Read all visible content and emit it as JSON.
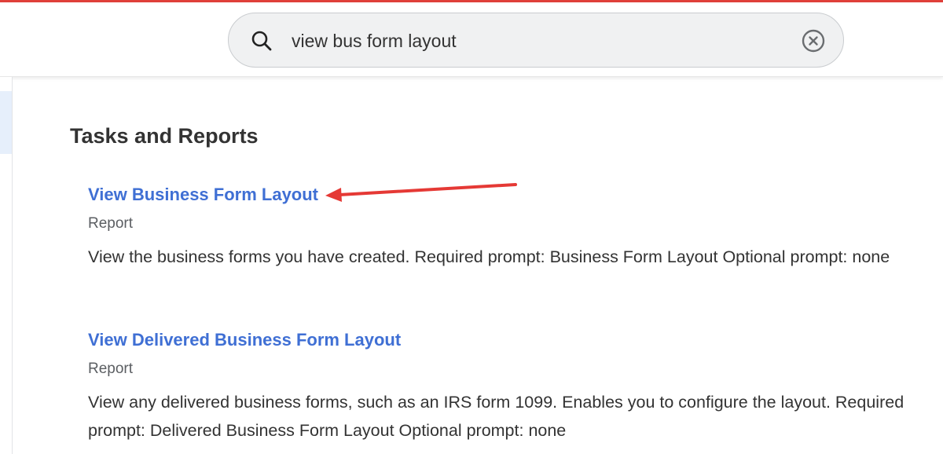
{
  "search": {
    "value": "view bus form layout",
    "icon": "search-icon",
    "clear_icon": "clear-icon"
  },
  "colors": {
    "accent_bar": "#e0403a",
    "link": "#3f6fd4",
    "annotation_arrow": "#e53935"
  },
  "main": {
    "section_title": "Tasks and Reports",
    "results": [
      {
        "title": "View Business Form Layout",
        "type": "Report",
        "description": "View the business forms you have created. Required prompt: Business Form Layout Optional prompt: none"
      },
      {
        "title": "View Delivered Business Form Layout",
        "type": "Report",
        "description": "View any delivered business forms, such as an IRS form 1099. Enables you to configure the layout. Required prompt: Delivered Business Form Layout Optional prompt: none"
      }
    ]
  }
}
